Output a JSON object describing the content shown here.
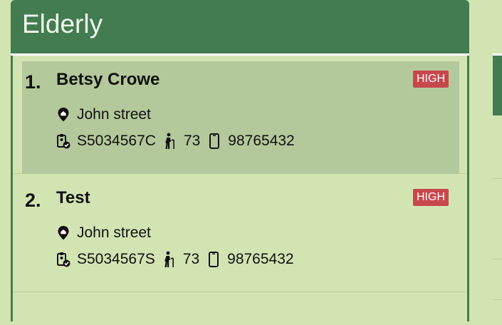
{
  "panel": {
    "title": "Elderly"
  },
  "cards": [
    {
      "index": "1.",
      "name": "Betsy Crowe",
      "priority": "HIGH",
      "address": "John street",
      "nric": "S5034567C",
      "age": "73",
      "phone": "98765432"
    },
    {
      "index": "2.",
      "name": "Test",
      "priority": "HIGH",
      "address": "John street",
      "nric": "S5034567S",
      "age": "73",
      "phone": "98765432"
    }
  ],
  "colors": {
    "background": "#d3e4b3",
    "header": "#437c50",
    "selected": "#b4c99b",
    "badge": "#c8474c"
  },
  "icons": [
    "location-pin-icon",
    "id-card-icon",
    "elderly-person-icon",
    "phone-icon"
  ]
}
